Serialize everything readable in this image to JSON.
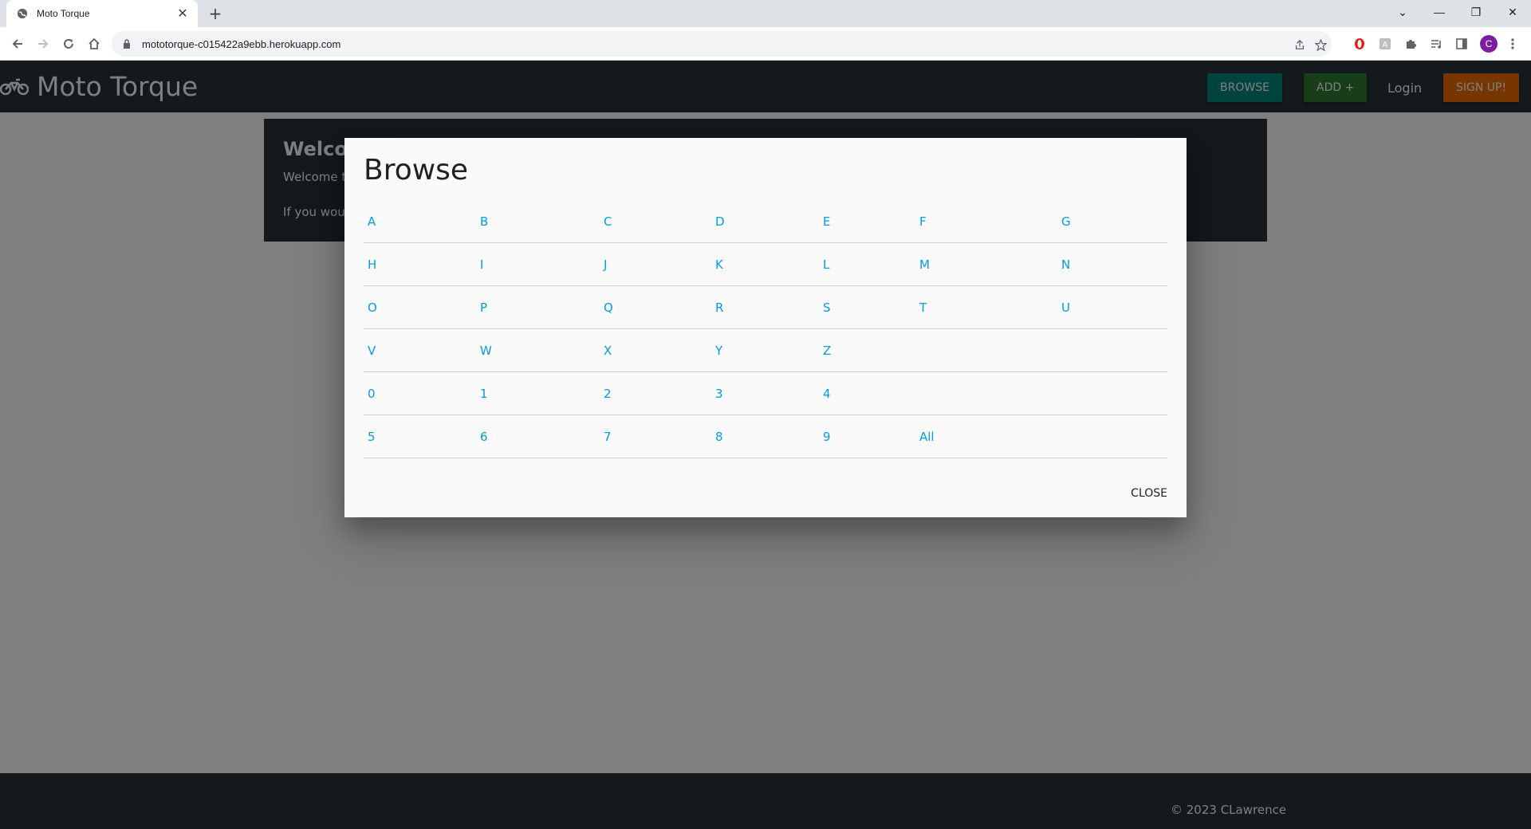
{
  "browser": {
    "tab_title": "Moto Torque",
    "url": "mototorque-c015422a9ebb.herokuapp.com",
    "profile_initial": "C"
  },
  "site": {
    "brand": "Moto Torque",
    "nav": {
      "browse": "BROWSE",
      "add": "ADD +",
      "login": "Login",
      "signup": "SIGN UP!"
    },
    "welcome": {
      "title": "Welcor",
      "line1": "Welcome t",
      "line2": "If you woul"
    },
    "footer": "© 2023 CLawrence"
  },
  "modal": {
    "title": "Browse",
    "close_label": "CLOSE",
    "rows": [
      [
        "A",
        "B",
        "C",
        "D",
        "E",
        "F",
        "G"
      ],
      [
        "H",
        "I",
        "J",
        "K",
        "L",
        "M",
        "N"
      ],
      [
        "O",
        "P",
        "Q",
        "R",
        "S",
        "T",
        "U"
      ],
      [
        "V",
        "W",
        "X",
        "Y",
        "Z",
        "",
        ""
      ],
      [
        "0",
        "1",
        "2",
        "3",
        "4",
        "",
        ""
      ],
      [
        "5",
        "6",
        "7",
        "8",
        "9",
        "All",
        ""
      ]
    ]
  },
  "colors": {
    "navbar": "#263238",
    "browse_button": "#00897b",
    "add_button": "#2e7d32",
    "signup_button": "#ef6c00",
    "link": "#039be5"
  }
}
